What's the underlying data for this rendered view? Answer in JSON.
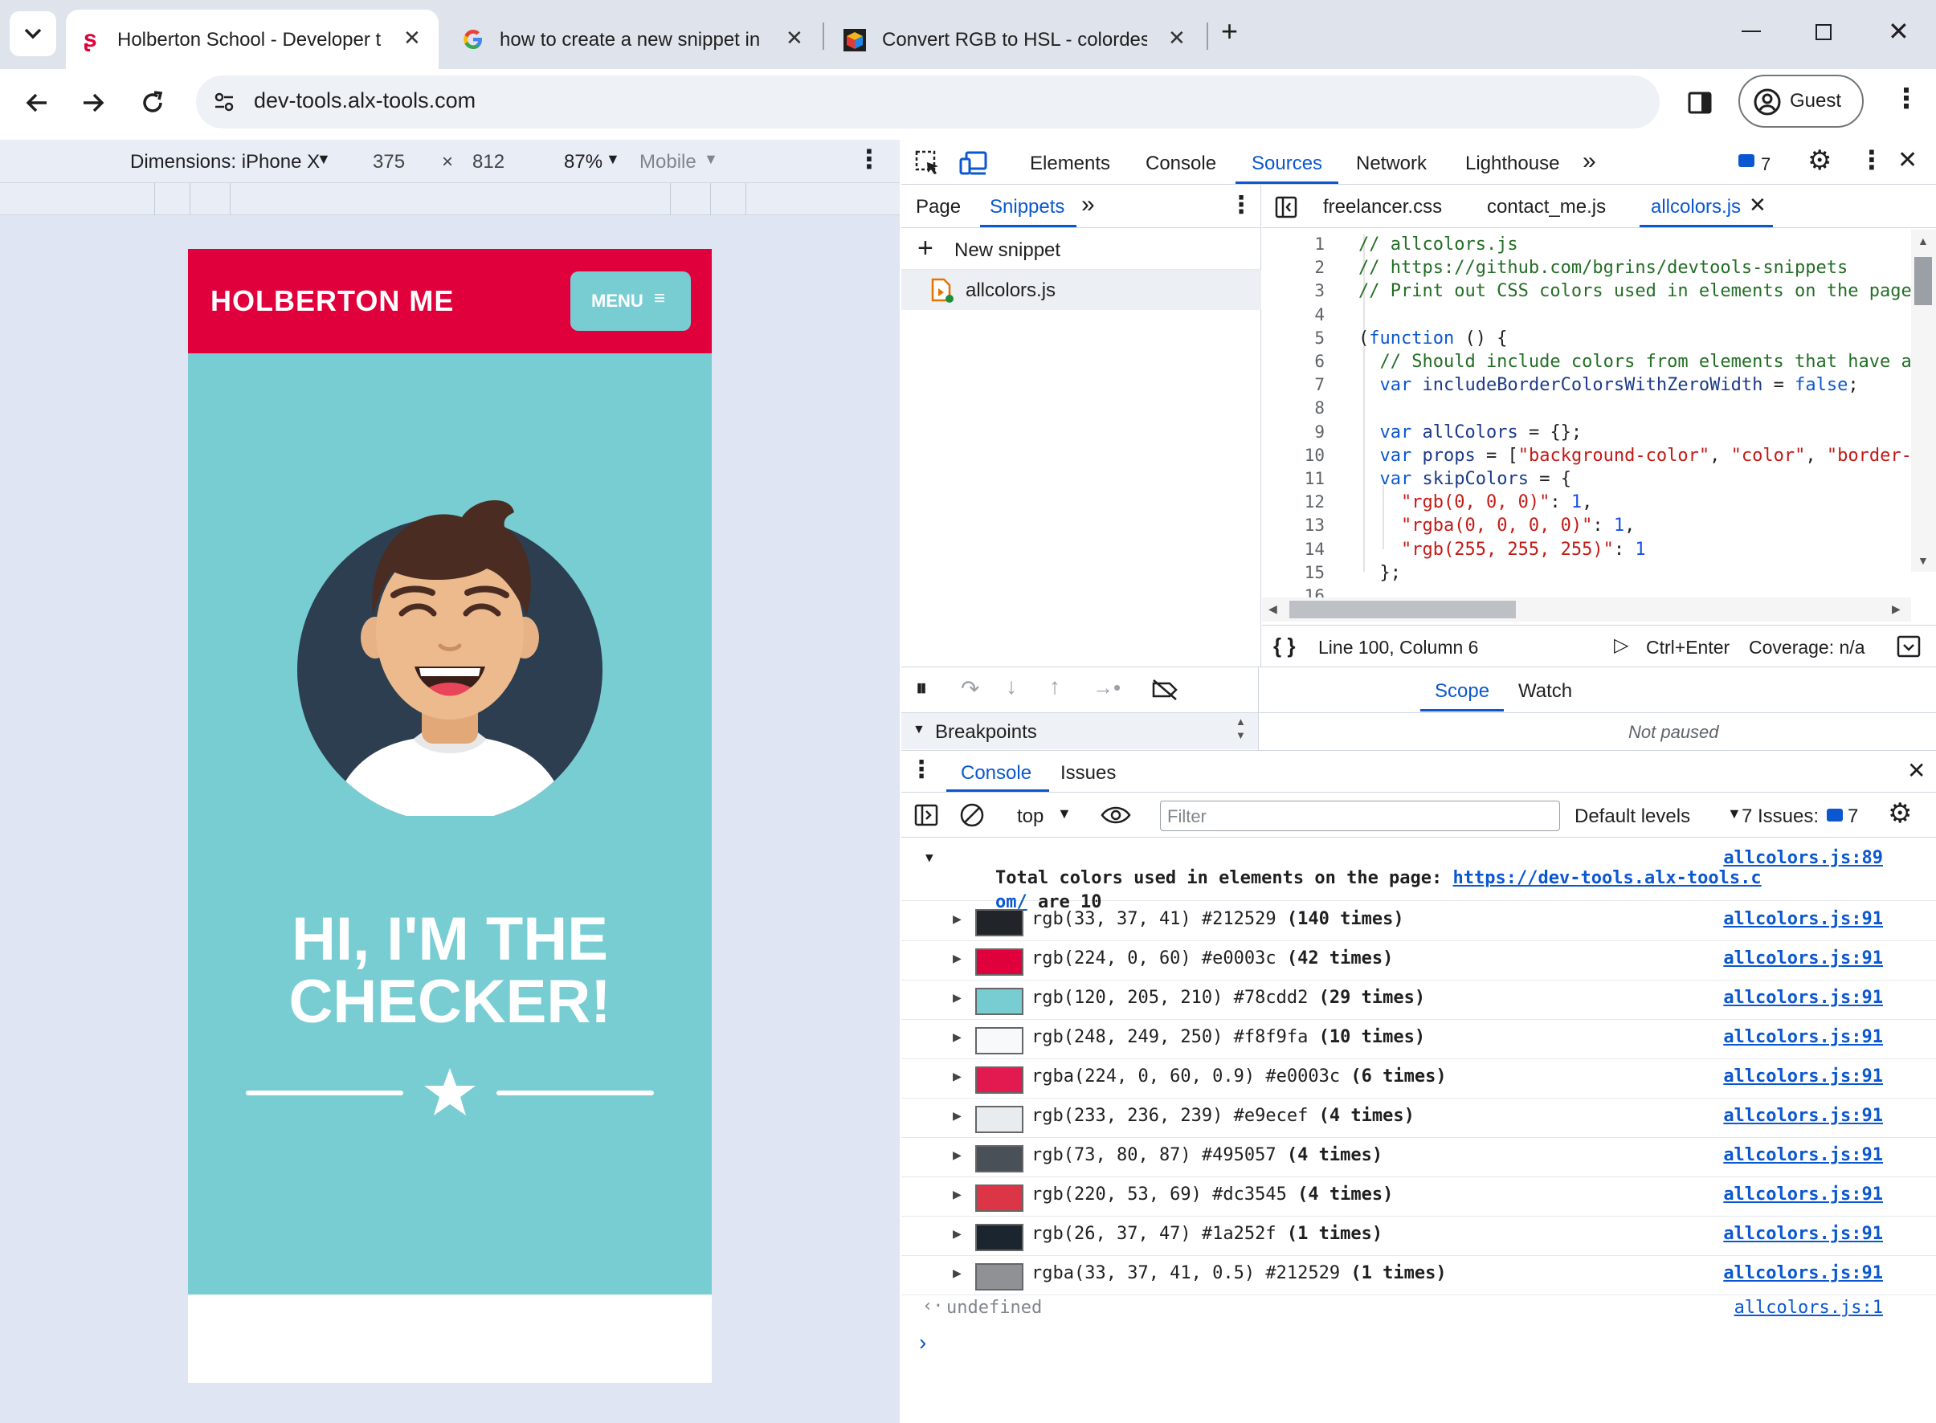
{
  "browser": {
    "tabs": [
      {
        "title": "Holberton School - Developer t",
        "active": true,
        "icon": "seahorse-icon"
      },
      {
        "title": "how to create a new snippet in",
        "active": false,
        "icon": "google-g-icon"
      },
      {
        "title": "Convert RGB to HSL - colordesi",
        "active": false,
        "icon": "colordesigner-cube-icon"
      }
    ],
    "url": "dev-tools.alx-tools.com",
    "profile_label": "Guest"
  },
  "device_toolbar": {
    "dimensions_label": "Dimensions: iPhone X",
    "width": "375",
    "times": "×",
    "height": "812",
    "zoom": "87%",
    "mode": "Mobile"
  },
  "site": {
    "brand": "HOLBERTON ME",
    "menu_label": "MENU",
    "hero_line1": "HI, I'M THE",
    "hero_line2": "CHECKER!"
  },
  "devtools": {
    "main_tabs": [
      "Elements",
      "Console",
      "Sources",
      "Network",
      "Lighthouse"
    ],
    "active_main_tab": "Sources",
    "issues_badge": "7",
    "nav_tabs": [
      "Page",
      "Snippets"
    ],
    "active_nav_tab": "Snippets",
    "new_snippet_label": "New snippet",
    "snippet_file": "allcolors.js",
    "editor_tabs": [
      "freelancer.css",
      "contact_me.js",
      "allcolors.js"
    ],
    "active_editor_tab": "allcolors.js",
    "status_position": "Line 100, Column 6",
    "status_run": "Ctrl+Enter",
    "status_coverage": "Coverage: n/a",
    "breakpoints_label": "Breakpoints",
    "scope_tab": "Scope",
    "watch_tab": "Watch",
    "not_paused": "Not paused",
    "drawer_tabs": [
      "Console",
      "Issues"
    ],
    "context_label": "top",
    "filter_placeholder": "Filter",
    "levels_label": "Default levels",
    "issues_label": "7 Issues:",
    "issues_count": "7"
  },
  "code_lines": [
    {
      "n": "1",
      "parts": [
        [
          "// allcolors.js",
          "c-cm"
        ]
      ]
    },
    {
      "n": "2",
      "parts": [
        [
          "// https://github.com/bgrins/devtools-snippets",
          "c-cm"
        ]
      ]
    },
    {
      "n": "3",
      "parts": [
        [
          "// Print out CSS colors used in elements on the page",
          "c-cm"
        ]
      ]
    },
    {
      "n": "4",
      "parts": []
    },
    {
      "n": "5",
      "parts": [
        [
          "(",
          "c-plain"
        ],
        [
          "function",
          "c-kw"
        ],
        [
          " () {",
          "c-plain"
        ]
      ]
    },
    {
      "n": "6",
      "parts": [
        [
          "  // Should include colors from elements that have a",
          "c-cm"
        ]
      ]
    },
    {
      "n": "7",
      "parts": [
        [
          "  ",
          "c-plain"
        ],
        [
          "var",
          "c-kw"
        ],
        [
          " includeBorderColorsWithZeroWidth",
          "c-var"
        ],
        [
          " = ",
          "c-plain"
        ],
        [
          "false",
          "c-kw"
        ],
        [
          ";",
          "c-plain"
        ]
      ]
    },
    {
      "n": "8",
      "parts": []
    },
    {
      "n": "9",
      "parts": [
        [
          "  ",
          "c-plain"
        ],
        [
          "var",
          "c-kw"
        ],
        [
          " allColors",
          "c-var"
        ],
        [
          " = {};",
          "c-plain"
        ]
      ]
    },
    {
      "n": "10",
      "parts": [
        [
          "  ",
          "c-plain"
        ],
        [
          "var",
          "c-kw"
        ],
        [
          " props",
          "c-var"
        ],
        [
          " = [",
          "c-plain"
        ],
        [
          "\"background-color\"",
          "c-str"
        ],
        [
          ", ",
          "c-plain"
        ],
        [
          "\"color\"",
          "c-str"
        ],
        [
          ", ",
          "c-plain"
        ],
        [
          "\"border-",
          "c-str"
        ]
      ]
    },
    {
      "n": "11",
      "parts": [
        [
          "  ",
          "c-plain"
        ],
        [
          "var",
          "c-kw"
        ],
        [
          " skipColors",
          "c-var"
        ],
        [
          " = {",
          "c-plain"
        ]
      ]
    },
    {
      "n": "12",
      "parts": [
        [
          "    ",
          "c-plain"
        ],
        [
          "\"rgb(0, 0, 0)\"",
          "c-str"
        ],
        [
          ": ",
          "c-plain"
        ],
        [
          "1",
          "c-num"
        ],
        [
          ",",
          "c-plain"
        ]
      ]
    },
    {
      "n": "13",
      "parts": [
        [
          "    ",
          "c-plain"
        ],
        [
          "\"rgba(0, 0, 0, 0)\"",
          "c-str"
        ],
        [
          ": ",
          "c-plain"
        ],
        [
          "1",
          "c-num"
        ],
        [
          ",",
          "c-plain"
        ]
      ]
    },
    {
      "n": "14",
      "parts": [
        [
          "    ",
          "c-plain"
        ],
        [
          "\"rgb(255, 255, 255)\"",
          "c-str"
        ],
        [
          ": ",
          "c-plain"
        ],
        [
          "1",
          "c-num"
        ]
      ]
    },
    {
      "n": "15",
      "parts": [
        [
          "  };",
          "c-plain"
        ]
      ]
    },
    {
      "n": "16",
      "parts": []
    }
  ],
  "console": {
    "summary_text": "Total colors used in elements on the page: ",
    "summary_link1": "https://dev-tools.alx-tools.c",
    "summary_link2": "om/",
    "summary_tail": " are 10",
    "summary_src": "allcolors.js:89",
    "rows": [
      {
        "value": "rgb(33, 37, 41) #212529",
        "count": "(140 times)",
        "color": "#212529",
        "src": "allcolors.js:91"
      },
      {
        "value": "rgb(224, 0, 60) #e0003c",
        "count": "(42 times)",
        "color": "#e0003c",
        "src": "allcolors.js:91"
      },
      {
        "value": "rgb(120, 205, 210) #78cdd2",
        "count": "(29 times)",
        "color": "#78cdd2",
        "src": "allcolors.js:91"
      },
      {
        "value": "rgb(248, 249, 250) #f8f9fa",
        "count": "(10 times)",
        "color": "#f8f9fa",
        "src": "allcolors.js:91"
      },
      {
        "value": "rgba(224, 0, 60, 0.9) #e0003c",
        "count": "(6 times)",
        "color": "#e31a50",
        "src": "allcolors.js:91"
      },
      {
        "value": "rgb(233, 236, 239) #e9ecef",
        "count": "(4 times)",
        "color": "#e9ecef",
        "src": "allcolors.js:91"
      },
      {
        "value": "rgb(73, 80, 87) #495057",
        "count": "(4 times)",
        "color": "#495057",
        "src": "allcolors.js:91"
      },
      {
        "value": "rgb(220, 53, 69) #dc3545",
        "count": "(4 times)",
        "color": "#dc3545",
        "src": "allcolors.js:91"
      },
      {
        "value": "rgb(26, 37, 47) #1a252f",
        "count": "(1 times)",
        "color": "#1a252f",
        "src": "allcolors.js:91"
      },
      {
        "value": "rgba(33, 37, 41, 0.5) #212529",
        "count": "(1 times)",
        "color": "#8f9194",
        "src": "allcolors.js:91"
      }
    ],
    "return_value": "undefined",
    "return_src": "allcolors.js:1"
  },
  "colors": {
    "accent": "#0b57d0",
    "brand_red": "#e0003c",
    "brand_teal": "#78cdd2"
  }
}
